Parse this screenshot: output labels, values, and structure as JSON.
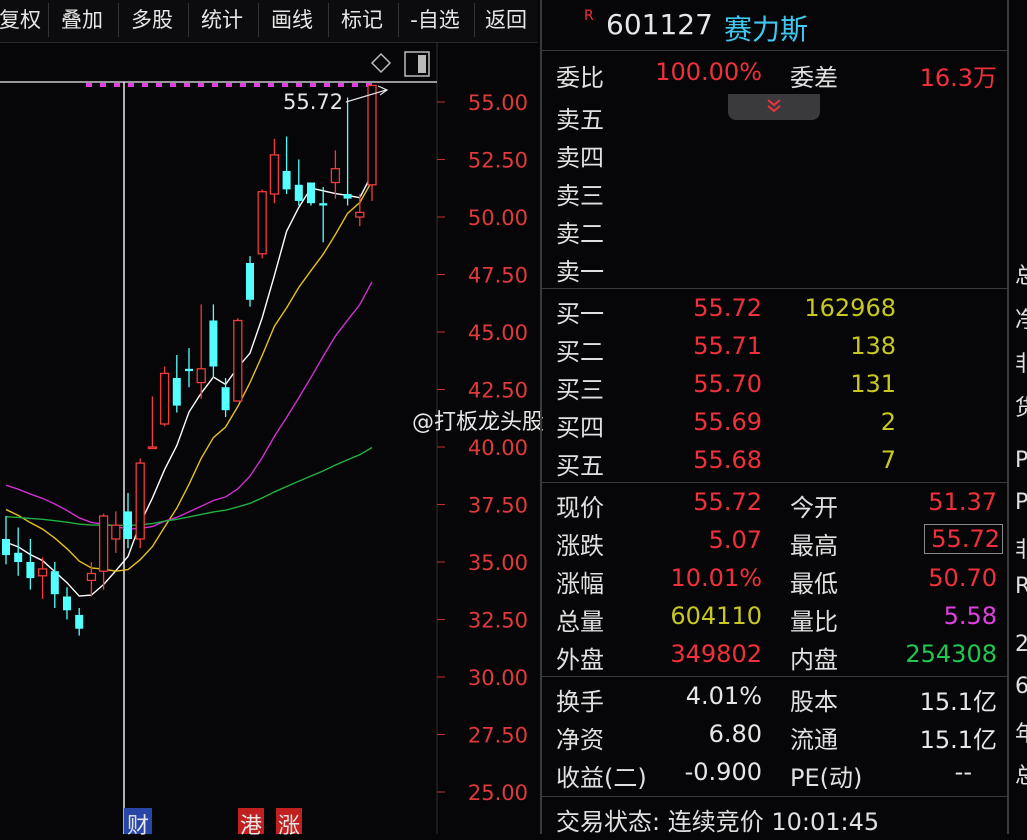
{
  "toolbar": {
    "buttons": [
      "复权",
      "叠加",
      "多股",
      "统计",
      "画线",
      "标记",
      "-自选",
      "返回"
    ]
  },
  "chart": {
    "price_label": "55.72",
    "y_ticks": [
      "55.00",
      "52.50",
      "50.00",
      "47.50",
      "45.00",
      "42.50",
      "40.00",
      "37.50",
      "35.00",
      "32.50",
      "30.00",
      "27.50",
      "25.00"
    ],
    "markers": [
      "财",
      "港",
      "涨"
    ],
    "watermark": "@打板龙头股"
  },
  "chart_data": {
    "type": "candlestick",
    "ylim": [
      25,
      56.5
    ],
    "candles": [
      {
        "o": 36.0,
        "h": 37.0,
        "l": 34.9,
        "c": 35.3
      },
      {
        "o": 35.4,
        "h": 36.5,
        "l": 34.4,
        "c": 35.0
      },
      {
        "o": 35.0,
        "h": 36.0,
        "l": 33.8,
        "c": 34.3
      },
      {
        "o": 34.4,
        "h": 35.2,
        "l": 33.4,
        "c": 34.7
      },
      {
        "o": 34.6,
        "h": 35.0,
        "l": 33.0,
        "c": 33.6
      },
      {
        "o": 33.5,
        "h": 33.9,
        "l": 32.5,
        "c": 32.9
      },
      {
        "o": 32.7,
        "h": 33.0,
        "l": 31.8,
        "c": 32.1
      },
      {
        "o": 34.2,
        "h": 35.0,
        "l": 33.5,
        "c": 34.5
      },
      {
        "o": 34.6,
        "h": 37.1,
        "l": 33.8,
        "c": 37.0
      },
      {
        "o": 36.0,
        "h": 37.2,
        "l": 35.4,
        "c": 36.6
      },
      {
        "o": 37.2,
        "h": 38.0,
        "l": 35.6,
        "c": 36.0
      },
      {
        "o": 36.0,
        "h": 39.5,
        "l": 35.6,
        "c": 39.3
      },
      {
        "o": 40.0,
        "h": 42.2,
        "l": 40.0,
        "c": 40.0
      },
      {
        "o": 41.0,
        "h": 43.5,
        "l": 40.9,
        "c": 43.2
      },
      {
        "o": 43.0,
        "h": 44.0,
        "l": 41.5,
        "c": 41.8
      },
      {
        "o": 43.4,
        "h": 44.3,
        "l": 42.6,
        "c": 43.3
      },
      {
        "o": 42.8,
        "h": 46.2,
        "l": 42.1,
        "c": 43.4
      },
      {
        "o": 45.5,
        "h": 46.2,
        "l": 43.0,
        "c": 43.5
      },
      {
        "o": 42.6,
        "h": 43.0,
        "l": 41.3,
        "c": 41.6
      },
      {
        "o": 42.0,
        "h": 45.6,
        "l": 42.0,
        "c": 45.5
      },
      {
        "o": 48.0,
        "h": 48.3,
        "l": 46.1,
        "c": 46.4
      },
      {
        "o": 48.4,
        "h": 51.2,
        "l": 48.2,
        "c": 51.1
      },
      {
        "o": 51.0,
        "h": 53.4,
        "l": 50.6,
        "c": 52.7
      },
      {
        "o": 52.0,
        "h": 53.5,
        "l": 51.0,
        "c": 51.2
      },
      {
        "o": 51.4,
        "h": 52.5,
        "l": 50.5,
        "c": 50.7
      },
      {
        "o": 51.5,
        "h": 51.5,
        "l": 50.5,
        "c": 50.6
      },
      {
        "o": 50.6,
        "h": 51.3,
        "l": 48.9,
        "c": 50.5
      },
      {
        "o": 51.5,
        "h": 52.9,
        "l": 50.8,
        "c": 52.1
      },
      {
        "o": 51.0,
        "h": 55.2,
        "l": 50.5,
        "c": 50.8
      },
      {
        "o": 50.0,
        "h": 51.0,
        "l": 49.6,
        "c": 50.2
      },
      {
        "o": 51.4,
        "h": 55.72,
        "l": 50.7,
        "c": 55.72
      }
    ]
  },
  "panel": {
    "code": "601127",
    "name": "赛力斯",
    "weibi_label": "委比",
    "weibi": "100.00%",
    "weicha_label": "委差",
    "weicha": "16.3万",
    "sells": [
      "卖五",
      "卖四",
      "卖三",
      "卖二",
      "卖一"
    ],
    "buys": [
      {
        "label": "买一",
        "price": "55.72",
        "vol": "162968"
      },
      {
        "label": "买二",
        "price": "55.71",
        "vol": "138"
      },
      {
        "label": "买三",
        "price": "55.70",
        "vol": "131"
      },
      {
        "label": "买四",
        "price": "55.69",
        "vol": "2"
      },
      {
        "label": "买五",
        "price": "55.68",
        "vol": "7"
      }
    ],
    "stats": {
      "xianjia_l": "现价",
      "xianjia": "55.72",
      "jinkai_l": "今开",
      "jinkai": "51.37",
      "zhangdie_l": "涨跌",
      "zhangdie": "5.07",
      "zuigao_l": "最高",
      "zuigao": "55.72",
      "zhangfu_l": "涨幅",
      "zhangfu": "10.01%",
      "zuidi_l": "最低",
      "zuidi": "50.70",
      "zongliang_l": "总量",
      "zongliang": "604110",
      "liangbi_l": "量比",
      "liangbi": "5.58",
      "waipan_l": "外盘",
      "waipan": "349802",
      "neipan_l": "内盘",
      "neipan": "254308"
    },
    "info": {
      "huanshou_l": "换手",
      "huanshou": "4.01%",
      "guben_l": "股本",
      "guben": "15.1亿",
      "jingzi_l": "净资",
      "jingzi": "6.80",
      "liutong_l": "流通",
      "liutong": "15.1亿",
      "shouyi_l": "收益(二)",
      "shouyi": "-0.900",
      "pe_l": "PE(动)",
      "pe": "--"
    },
    "status": "交易状态: 连续竞价 10:01:45"
  },
  "edge_text": [
    "总",
    "净",
    "非",
    "货",
    "P",
    "P",
    "非",
    "R",
    "2",
    "6",
    "年",
    "总"
  ]
}
